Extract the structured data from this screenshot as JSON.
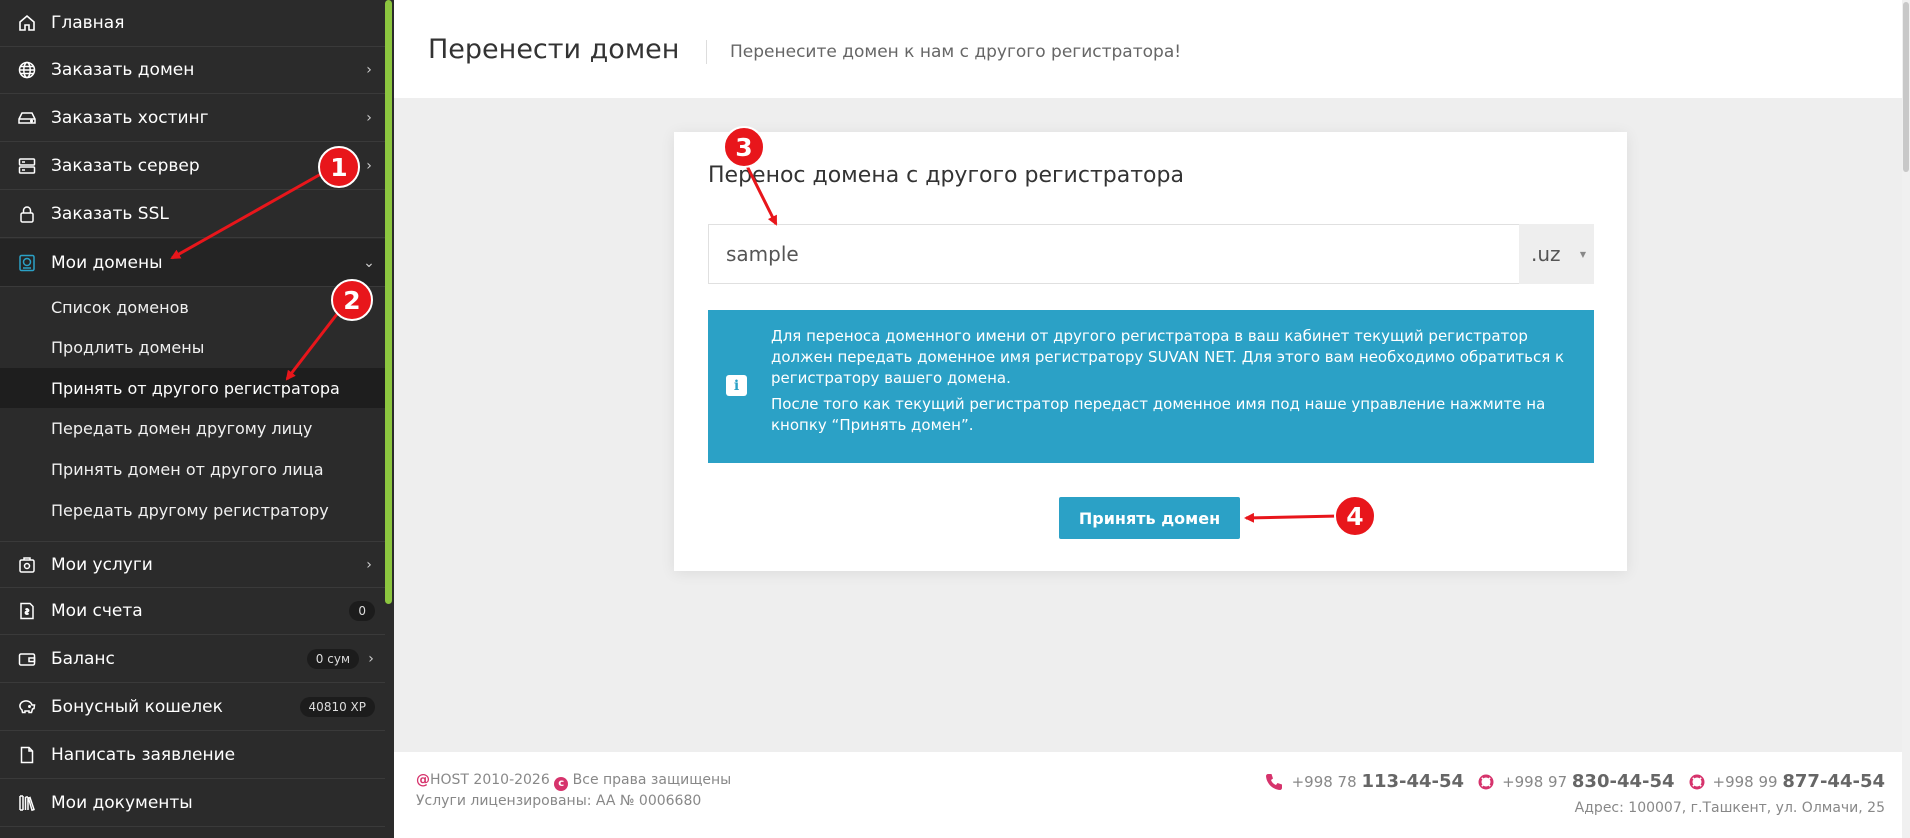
{
  "sidebar": {
    "items": [
      {
        "label": "Главная",
        "icon": "home-icon"
      },
      {
        "label": "Заказать домен",
        "icon": "globe-icon"
      },
      {
        "label": "Заказать хостинг",
        "icon": "hard-drive-icon"
      },
      {
        "label": "Заказать сервер",
        "icon": "server-icon"
      },
      {
        "label": "Заказать SSL",
        "icon": "lock-icon"
      },
      {
        "label": "Мои домены",
        "icon": "domain-icon"
      },
      {
        "label": "Мои услуги",
        "icon": "services-icon"
      },
      {
        "label": "Мои счета",
        "icon": "invoice-icon",
        "badge": "0"
      },
      {
        "label": "Баланс",
        "icon": "wallet-icon",
        "badge": "0 сум"
      },
      {
        "label": "Бонусный кошелек",
        "icon": "piggy-bank-icon",
        "badge": "40810 XP"
      },
      {
        "label": "Написать заявление",
        "icon": "document-icon"
      },
      {
        "label": "Мои документы",
        "icon": "books-icon"
      }
    ],
    "submenu": [
      {
        "label": "Список доменов"
      },
      {
        "label": "Продлить домены"
      },
      {
        "label": "Принять от другого регистратора"
      },
      {
        "label": "Передать домен другому лицу"
      },
      {
        "label": "Принять домен от другого лица"
      },
      {
        "label": "Передать другому регистратору"
      }
    ]
  },
  "header": {
    "title": "Перенести домен",
    "subtitle": "Перенесите домен к нам с другого регистратора!"
  },
  "card": {
    "title": "Перенос домена с другого регистратора",
    "domain_value": "sample",
    "tld_selected": ".uz",
    "info_p1": "Для переноса доменного имени от другого регистратора в ваш кабинет текущий регистратор должен передать доменное имя регистратору SUVAN NET. Для этого вам необходимо обратиться к регистратору вашего домена.",
    "info_p2": "После того как текущий регистратор передаст доменное имя под наше управление нажмите на кнопку “Принять домен”.",
    "button_label": "Принять домен"
  },
  "footer": {
    "at_sign": "@",
    "copyright_pre": "HOST 2010-2026",
    "copyright_post": "Все права защищены",
    "copyright_mark": "c",
    "license": "Услуги лицензированы: AA № 0006680",
    "phones": [
      {
        "prefix": "+998 78",
        "number": "113-44-54"
      },
      {
        "prefix": "+998 97",
        "number": "830-44-54"
      },
      {
        "prefix": "+998 99",
        "number": "877-44-54"
      }
    ],
    "address": "Адрес: 100007, г.Ташкент, ул. Олмачи, 25"
  },
  "annotations": {
    "markers": [
      "1",
      "2",
      "3",
      "4"
    ],
    "color": "#e8161b"
  },
  "colors": {
    "sidebar_bg": "#2b2b2b",
    "accent_green": "#8cc63f",
    "primary": "#2ba1c6",
    "footer_accent": "#d6336c"
  }
}
